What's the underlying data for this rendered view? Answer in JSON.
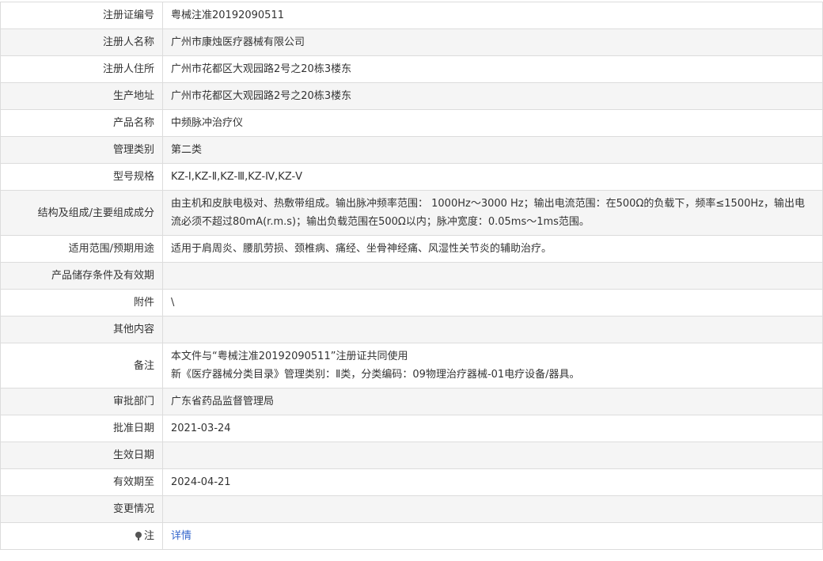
{
  "rows": [
    {
      "label": "注册证编号",
      "value": "粤械注准20192090511"
    },
    {
      "label": "注册人名称",
      "value": "广州市康烛医疗器械有限公司"
    },
    {
      "label": "注册人住所",
      "value": "广州市花都区大观园路2号之20栋3楼东"
    },
    {
      "label": "生产地址",
      "value": "广州市花都区大观园路2号之20栋3楼东"
    },
    {
      "label": "产品名称",
      "value": "中频脉冲治疗仪"
    },
    {
      "label": "管理类别",
      "value": "第二类"
    },
    {
      "label": "型号规格",
      "value": "KZ-Ⅰ,KZ-Ⅱ,KZ-Ⅲ,KZ-Ⅳ,KZ-Ⅴ"
    },
    {
      "label": "结构及组成/主要组成成分",
      "value": "由主机和皮肤电极对、热敷带组成。输出脉冲频率范围： 1000Hz～3000 Hz；输出电流范围：在500Ω的负载下，频率≤1500Hz，输出电流必须不超过80mA(r.m.s)；输出负载范围在500Ω以内；脉冲宽度：0.05ms～1ms范围。"
    },
    {
      "label": "适用范围/预期用途",
      "value": "适用于肩周炎、腰肌劳损、颈椎病、痛经、坐骨神经痛、风湿性关节炎的辅助治疗。"
    },
    {
      "label": "产品储存条件及有效期",
      "value": ""
    },
    {
      "label": "附件",
      "value": "\\"
    },
    {
      "label": "其他内容",
      "value": ""
    },
    {
      "label": "备注",
      "line1": "本文件与“粤械注准20192090511”注册证共同使用",
      "line2": "新《医疗器械分类目录》管理类别：Ⅱ类，分类编码：09物理治疗器械-01电疗设备/器具。"
    },
    {
      "label": "审批部门",
      "value": "广东省药品监督管理局"
    },
    {
      "label": "批准日期",
      "value": "2021-03-24"
    },
    {
      "label": "生效日期",
      "value": ""
    },
    {
      "label": "有效期至",
      "value": "2024-04-21"
    },
    {
      "label": "变更情况",
      "value": ""
    },
    {
      "label": "注",
      "value": "详情",
      "icon": "pin-icon"
    }
  ]
}
